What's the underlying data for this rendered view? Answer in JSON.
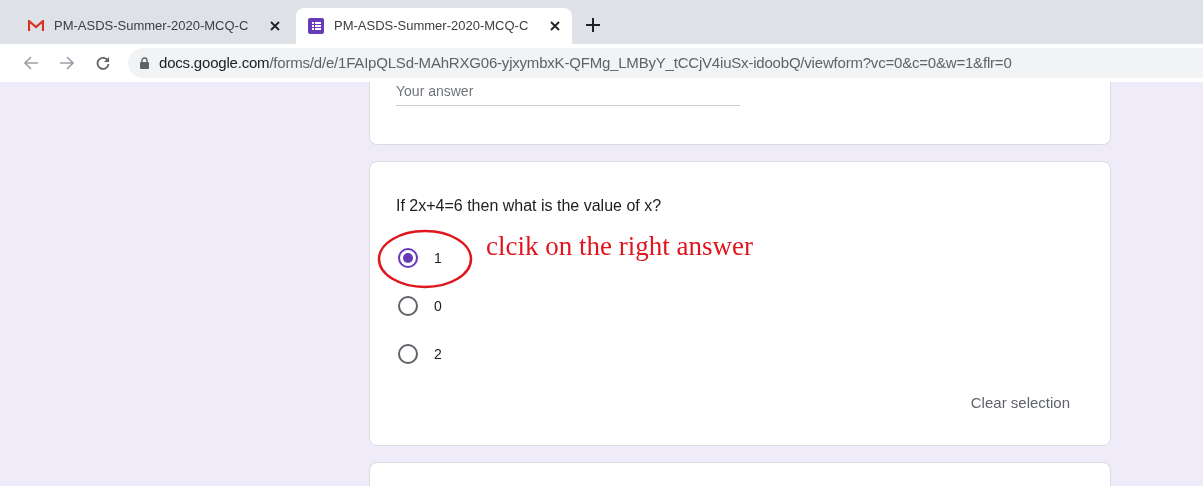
{
  "tabs": [
    {
      "title": "PM-ASDS-Summer-2020-MCQ-C",
      "kind": "mail",
      "selected": false
    },
    {
      "title": "PM-ASDS-Summer-2020-MCQ-C",
      "kind": "form",
      "selected": true
    }
  ],
  "address_bar": {
    "url_host": "docs.google.com",
    "url_path": "/forms/d/e/1FAIpQLSd-MAhRXG06-yjxymbxK-QFMg_LMByY_tCCjV4iuSx-idoobQ/viewform?vc=0&c=0&w=1&flr=0"
  },
  "previous_question": {
    "answer_placeholder": "Your answer"
  },
  "question": {
    "text": "If 2x+4=6 then what is the value of x?",
    "options": [
      {
        "label": "1",
        "selected": true
      },
      {
        "label": "0",
        "selected": false
      },
      {
        "label": "2",
        "selected": false
      }
    ],
    "clear_button": "Clear selection"
  },
  "annotation": {
    "text": "clcik on the right answer"
  }
}
